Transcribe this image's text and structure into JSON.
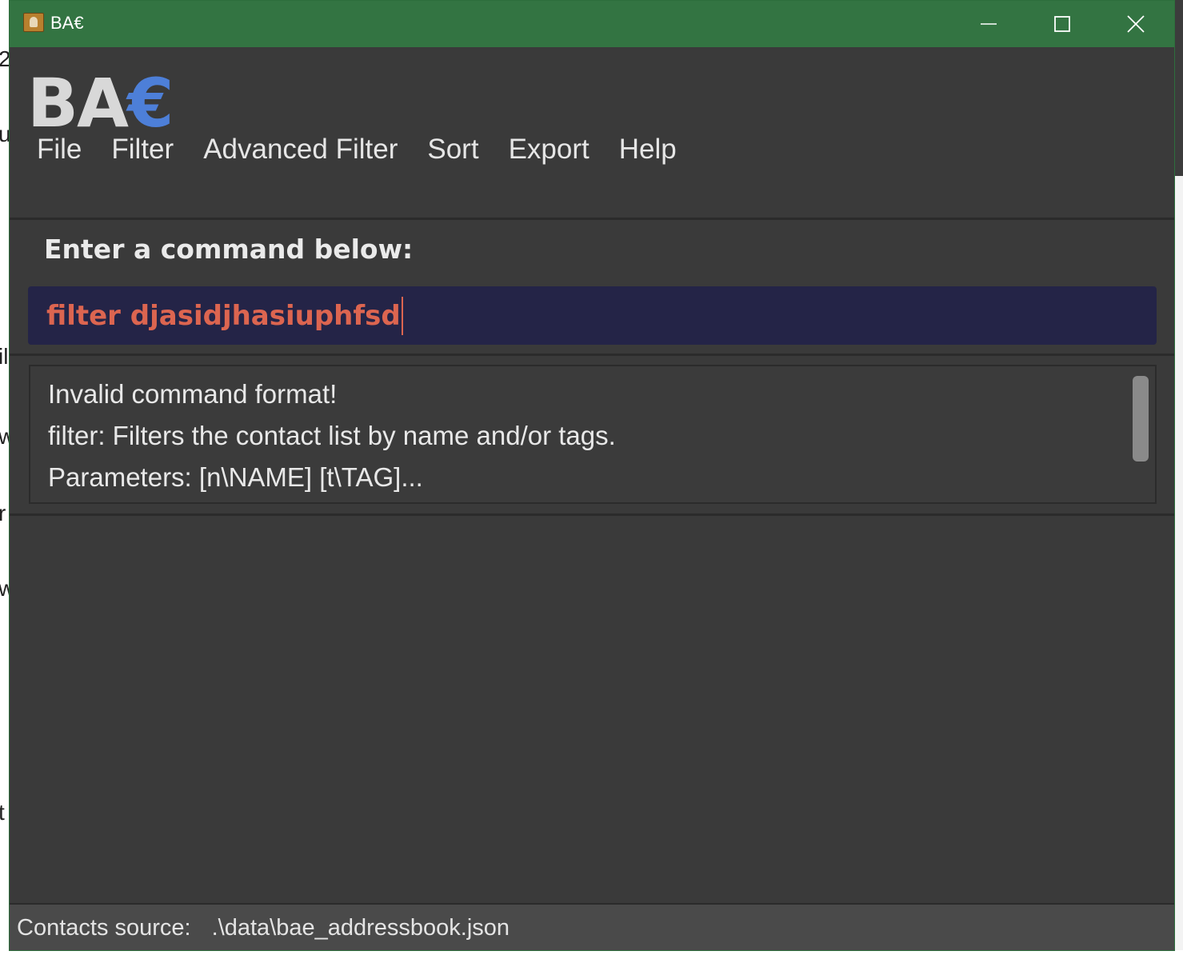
{
  "window": {
    "title": "BA€",
    "controls": {
      "minimize": "minimize",
      "maximize": "maximize",
      "close": "close"
    }
  },
  "header": {
    "logo_ba": "BA",
    "logo_euro": "€"
  },
  "menu": {
    "items": [
      "File",
      "Filter",
      "Advanced Filter",
      "Sort",
      "Export",
      "Help"
    ]
  },
  "command": {
    "label": "Enter a command below:",
    "value": "filter djasidjhasiuphfsd"
  },
  "result": {
    "lines": [
      "Invalid command format!",
      "filter: Filters the contact list by name and/or tags.",
      "Parameters: [n\\NAME] [t\\TAG]..."
    ]
  },
  "status": {
    "label": "Contacts source:",
    "path": ".\\data\\bae_addressbook.json"
  },
  "colors": {
    "titlebar": "#337442",
    "window_bg": "#3a3a3a",
    "command_bg": "#242447",
    "command_text": "#dc6550",
    "logo_euro": "#4d7fd8"
  },
  "icons": {
    "app": "address-book-icon",
    "minimize": "minimize-icon",
    "maximize": "maximize-icon",
    "close": "close-icon"
  }
}
